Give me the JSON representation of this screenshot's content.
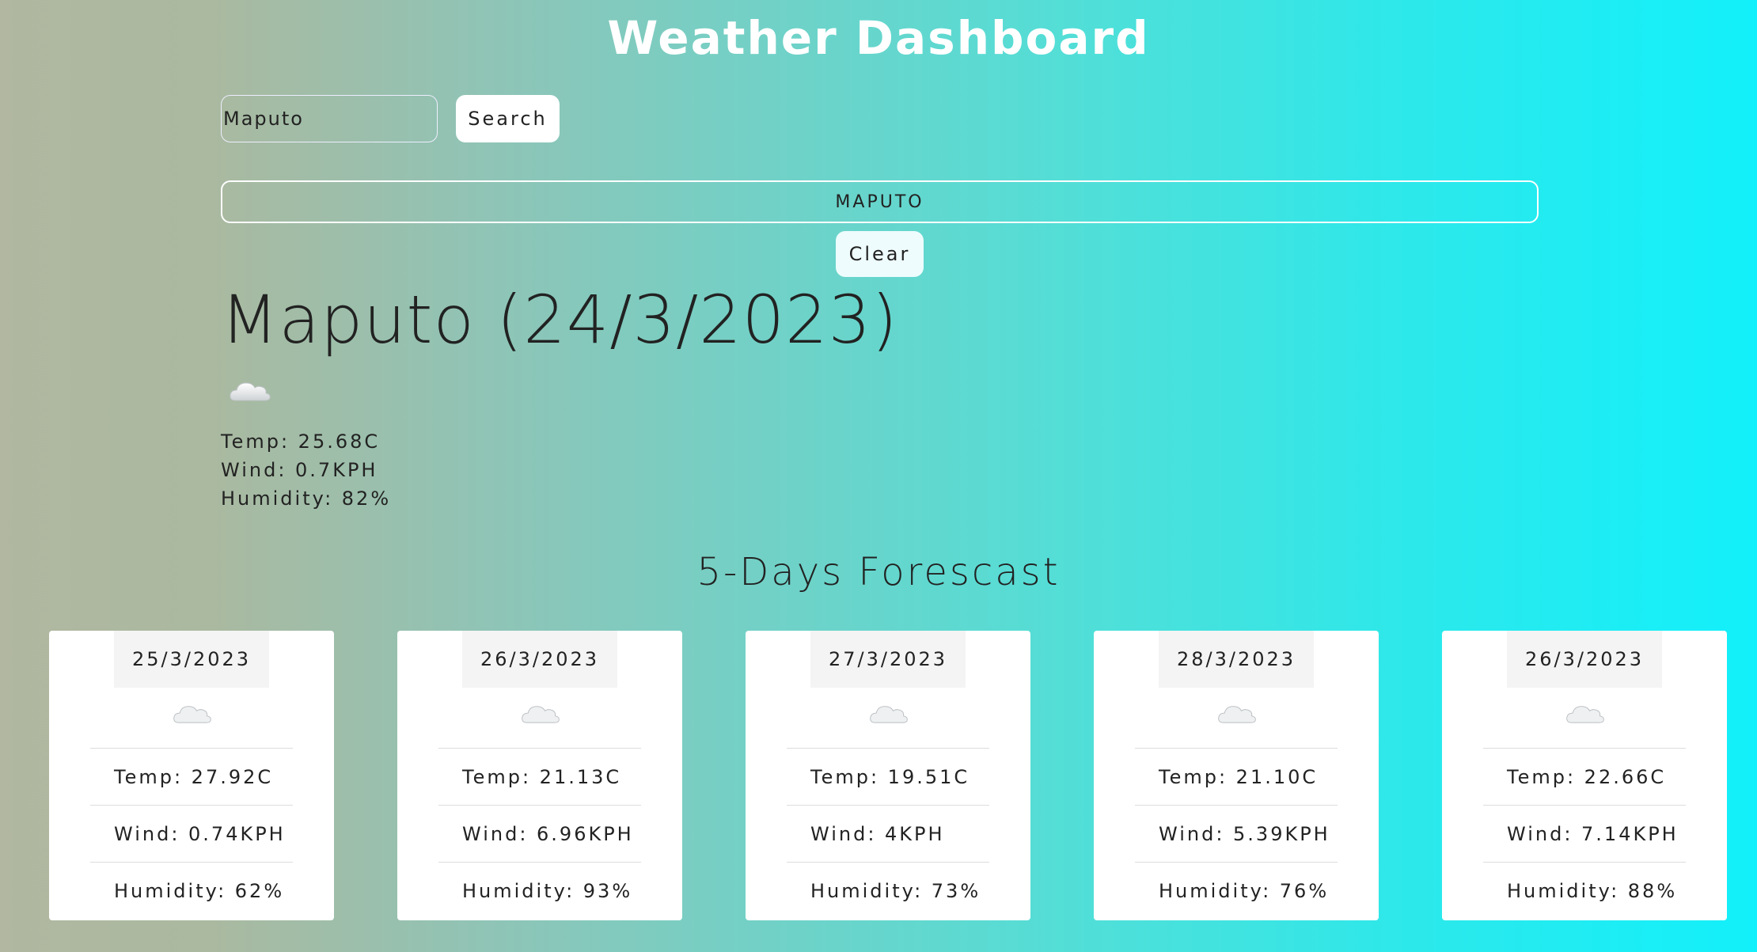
{
  "header": {
    "title": "Weather Dashboard"
  },
  "search": {
    "value": "Maputo",
    "button_label": "Search"
  },
  "history": {
    "items": [
      "MAPUTO"
    ],
    "clear_label": "Clear"
  },
  "current": {
    "heading": "Maputo (24/3/2023)",
    "icon": "cloud-icon",
    "temp": "Temp: 25.68C",
    "wind": "Wind: 0.7KPH",
    "humidity": "Humidity: 82%"
  },
  "forecast": {
    "title": "5-Days Forescast",
    "days": [
      {
        "date": "25/3/2023",
        "icon": "cloud-icon",
        "temp": "Temp: 27.92C",
        "wind": "Wind: 0.74KPH",
        "humidity": "Humidity: 62%"
      },
      {
        "date": "26/3/2023",
        "icon": "cloud-icon",
        "temp": "Temp: 21.13C",
        "wind": "Wind: 6.96KPH",
        "humidity": "Humidity: 93%"
      },
      {
        "date": "27/3/2023",
        "icon": "cloud-icon",
        "temp": "Temp: 19.51C",
        "wind": "Wind: 4KPH",
        "humidity": "Humidity: 73%"
      },
      {
        "date": "28/3/2023",
        "icon": "cloud-icon",
        "temp": "Temp: 21.10C",
        "wind": "Wind: 5.39KPH",
        "humidity": "Humidity: 76%"
      },
      {
        "date": "26/3/2023",
        "icon": "cloud-icon",
        "temp": "Temp: 22.66C",
        "wind": "Wind: 7.14KPH",
        "humidity": "Humidity: 88%"
      }
    ]
  }
}
